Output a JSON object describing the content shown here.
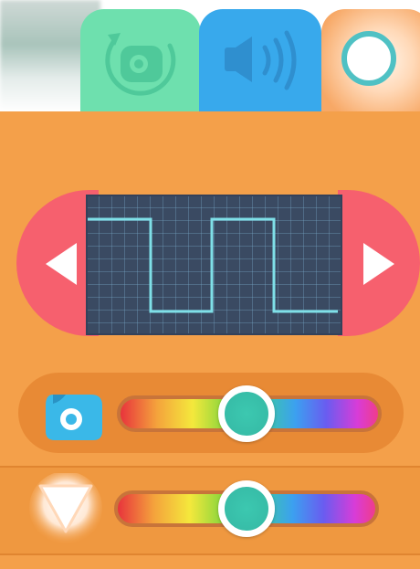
{
  "tabs": [
    {
      "name": "rotation",
      "icon": "rotate-tape-icon",
      "color": "#6ee0ae",
      "selected": false
    },
    {
      "name": "sound",
      "icon": "speaker-icon",
      "color": "#38a9ec",
      "selected": false
    },
    {
      "name": "color",
      "icon": "color-circle-icon",
      "color": "#f7a866",
      "selected": true
    }
  ],
  "waveform": {
    "type": "square",
    "line_color": "#7fe0e8",
    "background": "#3a4a62"
  },
  "navigation": {
    "prev_icon": "left-triangle-icon",
    "next_icon": "right-triangle-icon",
    "color": "#f6606e"
  },
  "sliders": [
    {
      "icon": "camera-dot-icon",
      "value_fraction": 0.49
    },
    {
      "icon": "triangle-glow-icon",
      "value_fraction": 0.5
    }
  ],
  "colors": {
    "panel": "#f4a04a",
    "knob_ring": "#ffffff",
    "knob_fill": "#3cc8b0"
  }
}
